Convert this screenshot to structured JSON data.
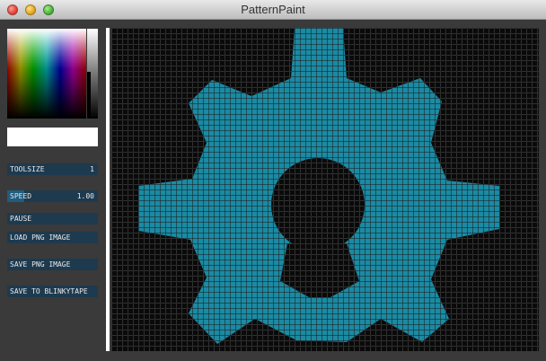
{
  "window": {
    "title": "PatternPaint"
  },
  "controls": {
    "toolsize": {
      "label": "TOOLSIZE",
      "value": "1"
    },
    "speed": {
      "label": "SPEED",
      "value": "1.00",
      "level": 0.19
    },
    "pause": {
      "label": "PAUSE"
    },
    "load": {
      "label": "LOAD PNG IMAGE"
    },
    "save": {
      "label": "SAVE PNG IMAGE"
    },
    "blinky": {
      "label": "SAVE TO BLINKYTAPE"
    }
  },
  "canvas": {
    "paint_color": "#1b8aa3",
    "background": "#0a0a0a"
  }
}
